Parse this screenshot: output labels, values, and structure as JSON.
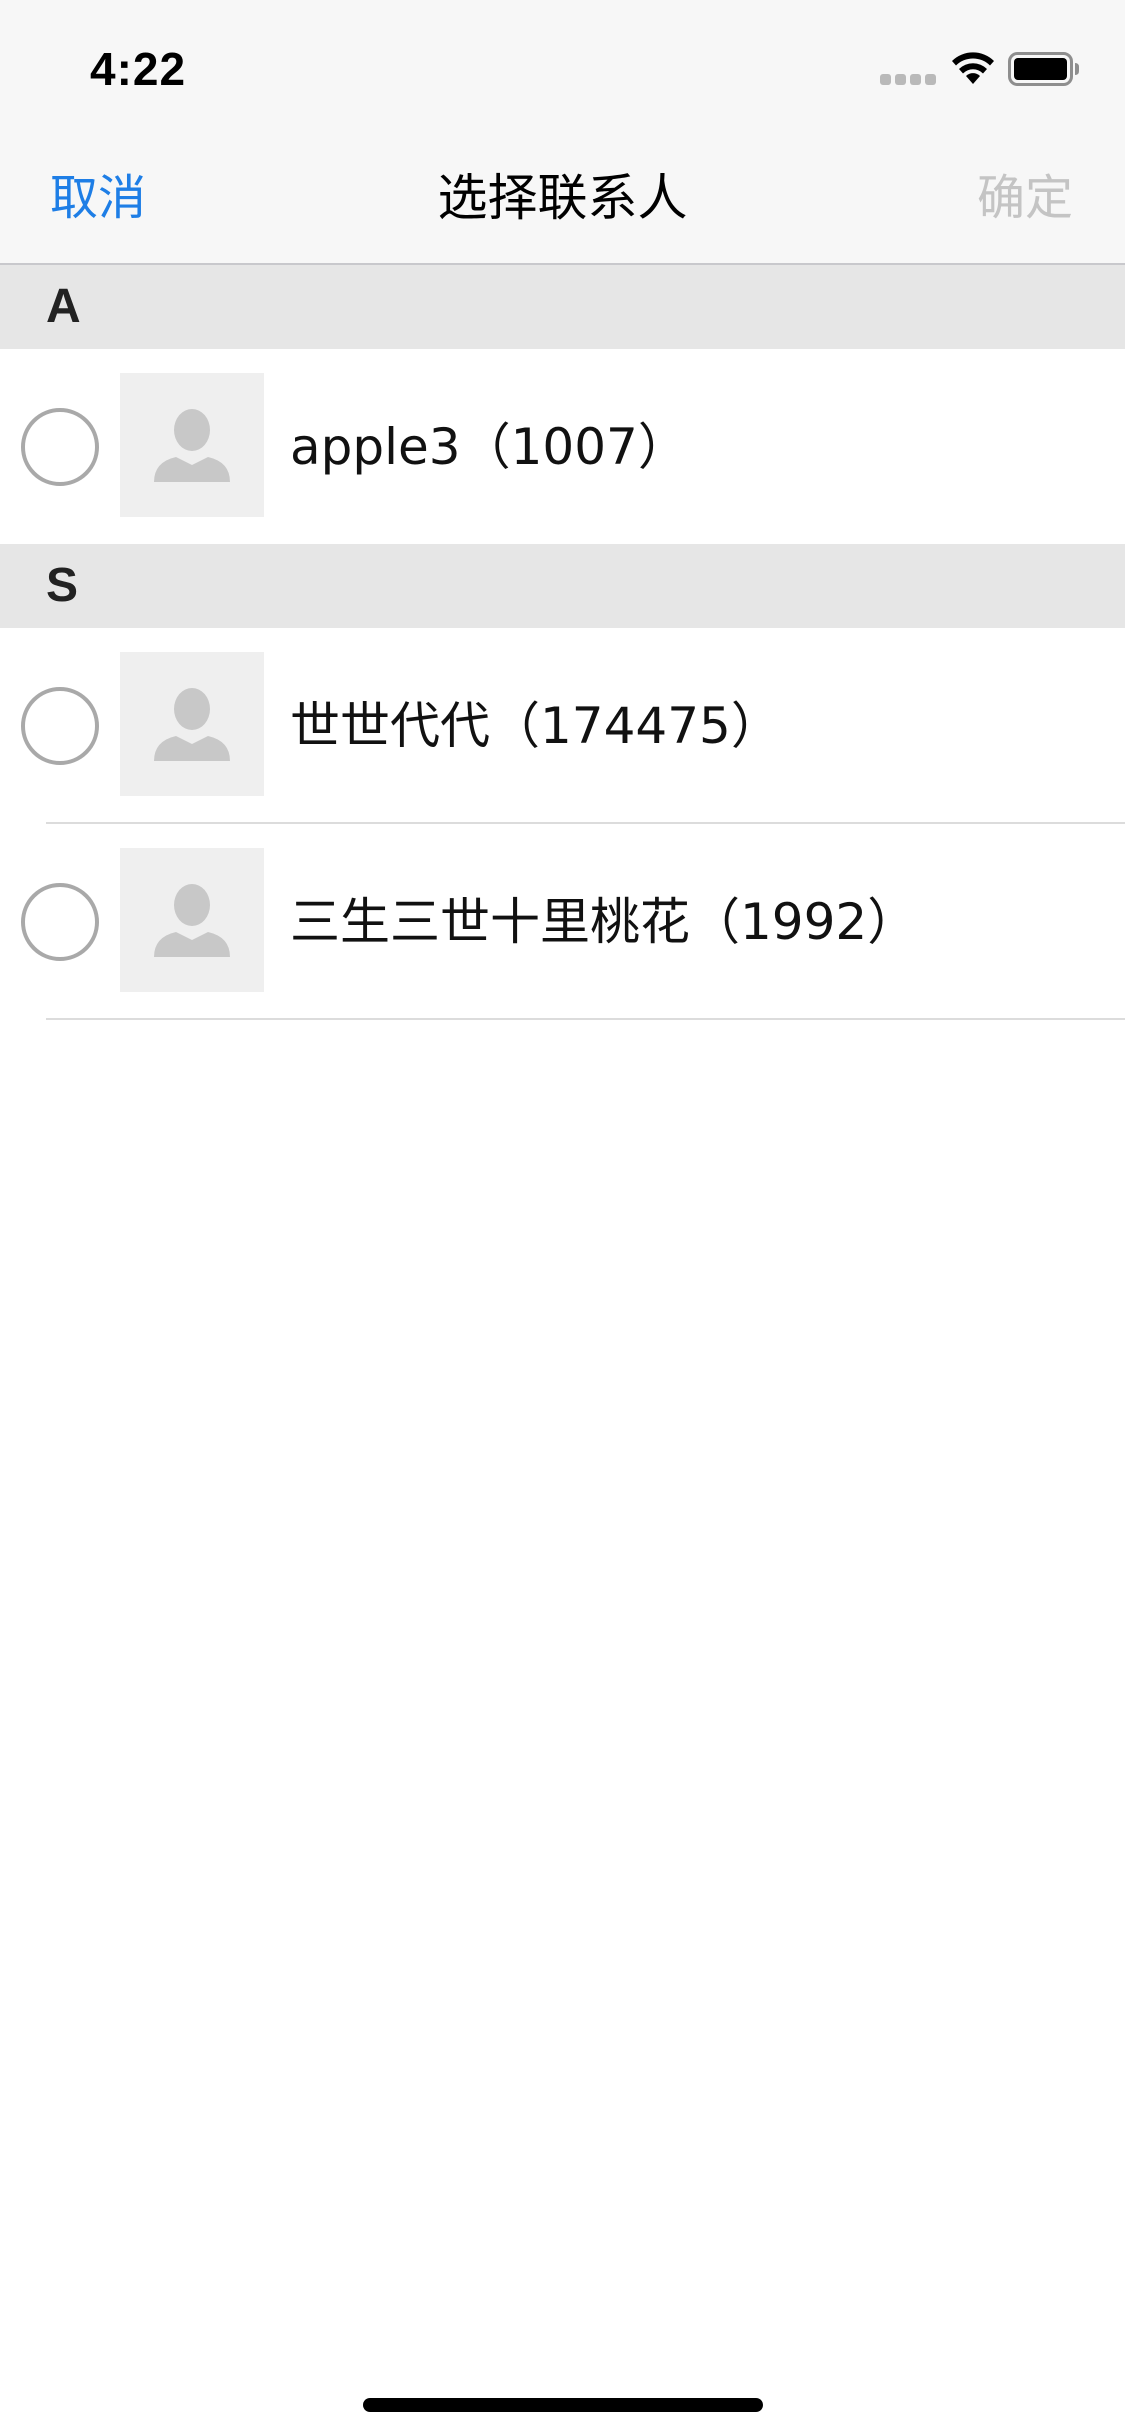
{
  "status_bar": {
    "time": "4:22",
    "icons": [
      "cellular-signal-icon",
      "wifi-icon",
      "battery-icon"
    ]
  },
  "nav": {
    "cancel_label": "取消",
    "title": "选择联系人",
    "confirm_label": "确定"
  },
  "colors": {
    "accent": "#1e7ee6",
    "disabled": "#c4c4c4",
    "section_bg": "#e6e6e6",
    "avatar_bg": "#efefef",
    "avatar_fg": "#c8c8c8"
  },
  "sections": [
    {
      "letter": "A",
      "contacts": [
        {
          "name": "apple3（1007）",
          "selected": false,
          "avatar_icon": "person-placeholder-icon"
        }
      ]
    },
    {
      "letter": "S",
      "contacts": [
        {
          "name": "世世代代（174475）",
          "selected": false,
          "avatar_icon": "person-placeholder-icon"
        },
        {
          "name": "三生三世十里桃花（1992）",
          "selected": false,
          "avatar_icon": "person-placeholder-icon"
        }
      ]
    }
  ]
}
